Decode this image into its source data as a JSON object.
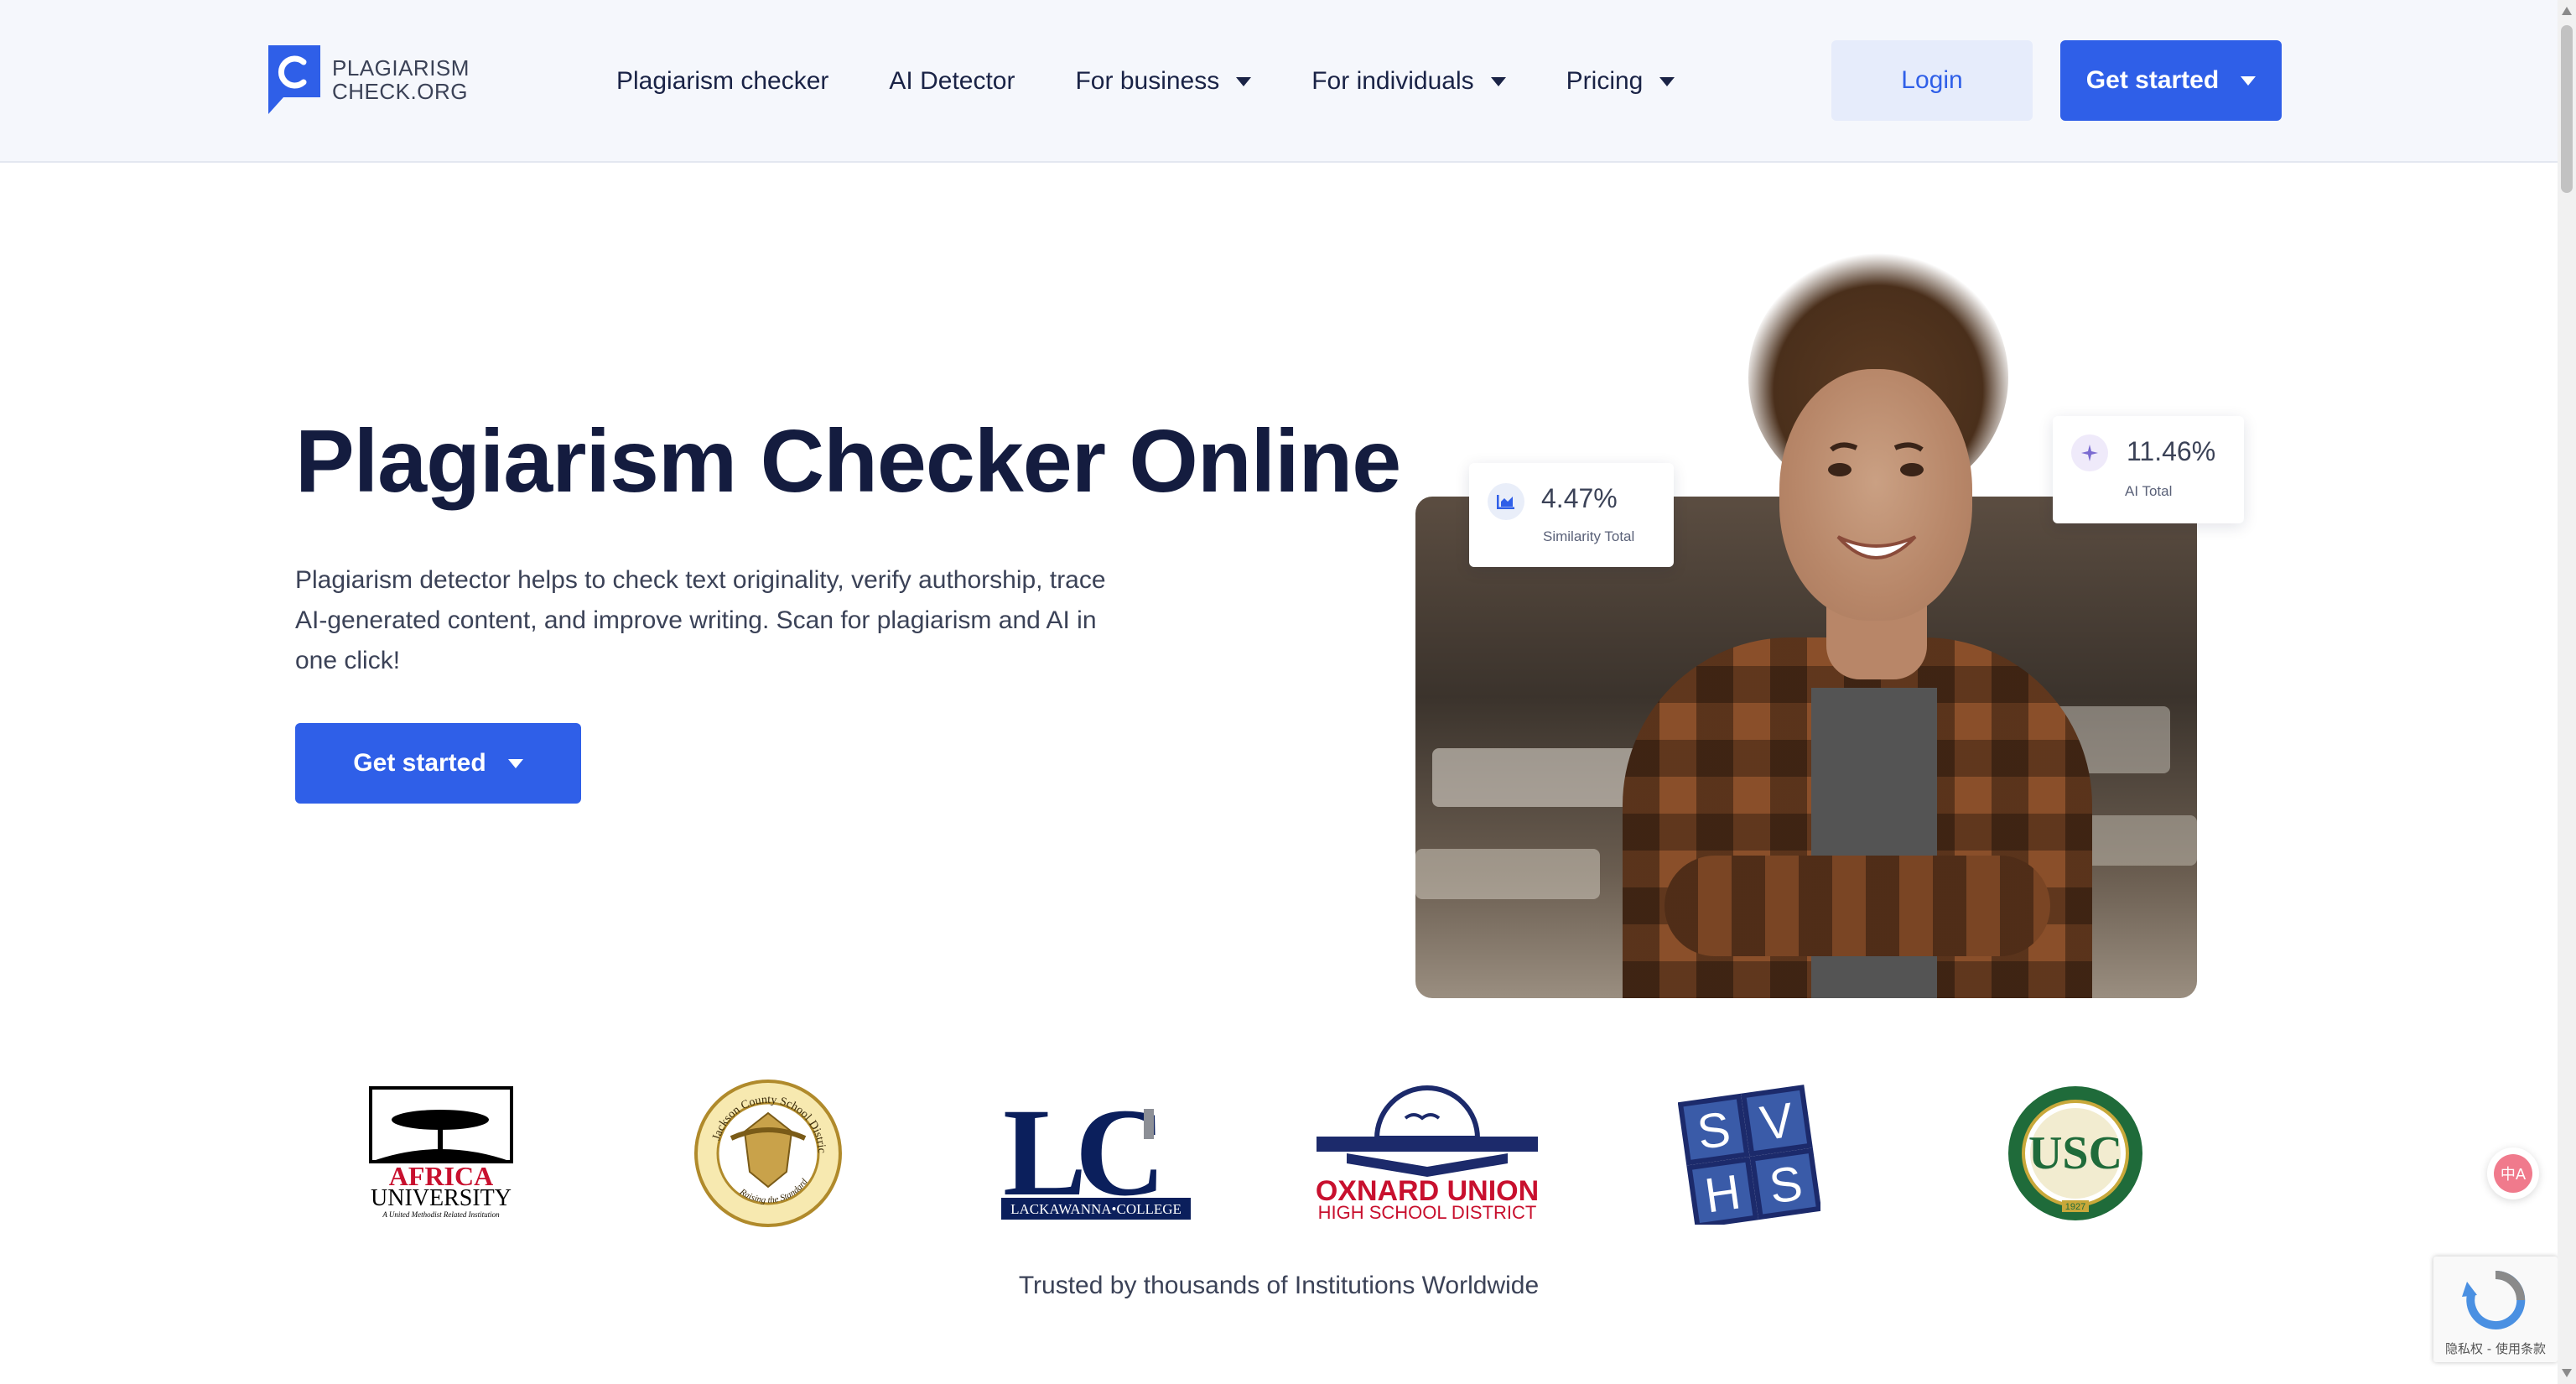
{
  "brand": {
    "logo_line1": "PLAGIARISM",
    "logo_line2": "CHECK.ORG",
    "primary_color": "#2f5fe8",
    "header_bg": "#f5f7fc",
    "title_color": "#141c3f"
  },
  "nav": {
    "items": [
      {
        "label": "Plagiarism checker",
        "has_dropdown": false
      },
      {
        "label": "AI Detector",
        "has_dropdown": false
      },
      {
        "label": "For business",
        "has_dropdown": true
      },
      {
        "label": "For individuals",
        "has_dropdown": true
      },
      {
        "label": "Pricing",
        "has_dropdown": true
      }
    ],
    "login_label": "Login",
    "get_started_label": "Get started"
  },
  "hero": {
    "title": "Plagiarism Checker Online",
    "description": "Plagiarism detector helps to check text originality, verify authorship, trace AI-generated content, and improve writing. Scan for plagiarism and AI in one click!",
    "cta_label": "Get started"
  },
  "stats": {
    "similarity": {
      "value": "4.47%",
      "label": "Similarity Total",
      "icon": "chart-icon"
    },
    "ai": {
      "value": "11.46%",
      "label": "AI Total",
      "icon": "sparkle-icon"
    }
  },
  "institutions": {
    "africa": {
      "line1": "AFRICA",
      "line2": "UNIVERSITY",
      "line3": "A United Methodist Related Institution"
    },
    "jackson": {
      "ring_text": "Jackson County School District",
      "motto": "Raising the Standard"
    },
    "lackawanna": {
      "mark": "LC",
      "name": "LACKAWANNA•COLLEGE"
    },
    "oxnard": {
      "line1": "OXNARD UNION",
      "line2": "HIGH SCHOOL DISTRICT"
    },
    "svhs": {
      "letters": [
        "S",
        "V",
        "H",
        "S"
      ]
    },
    "usc": {
      "mark": "USC",
      "year": "1927"
    },
    "trusted_text": "Trusted by thousands of Institutions Worldwide"
  },
  "widgets": {
    "translate_label": "中A",
    "recaptcha_text": "隐私权 - 使用条款"
  }
}
